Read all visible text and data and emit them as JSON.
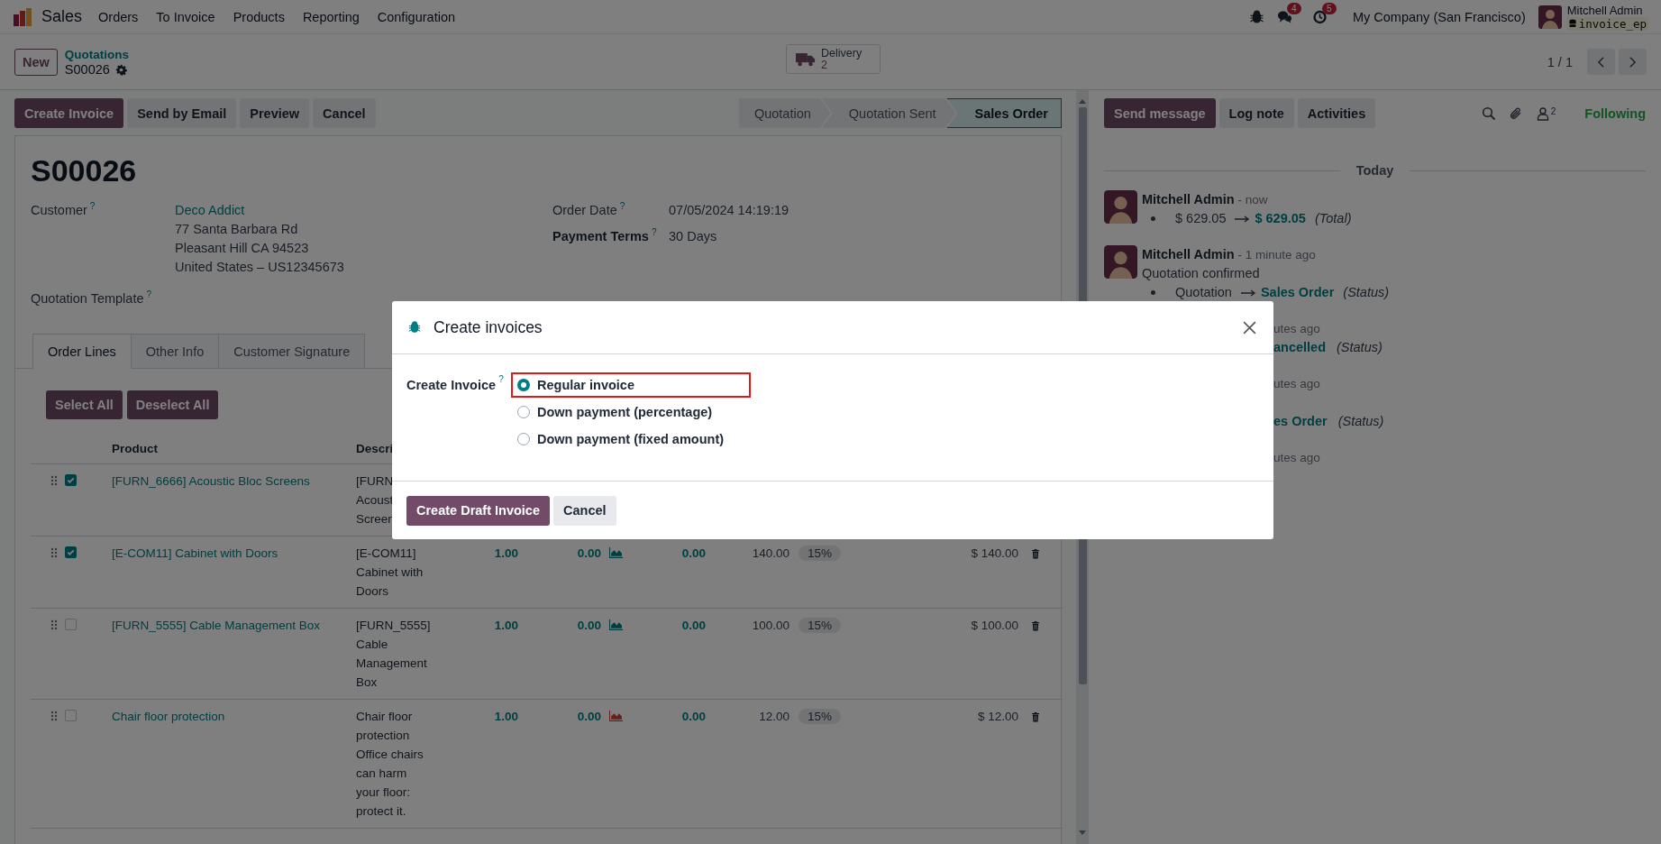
{
  "navbar": {
    "app": "Sales",
    "menu": [
      "Orders",
      "To Invoice",
      "Products",
      "Reporting",
      "Configuration"
    ],
    "messages_badge": "4",
    "activities_badge": "5",
    "company": "My Company (San Francisco)",
    "user": "Mitchell Admin",
    "database": "invoice_ep"
  },
  "control_panel": {
    "new_button": "New",
    "breadcrumb": "Quotations",
    "record": "S00026",
    "smart_button": {
      "label": "Delivery",
      "count": "2"
    },
    "pager": "1 / 1"
  },
  "actions": [
    {
      "label": "Create Invoice",
      "kind": "primary"
    },
    {
      "label": "Send by Email",
      "kind": "secondary"
    },
    {
      "label": "Preview",
      "kind": "secondary"
    },
    {
      "label": "Cancel",
      "kind": "secondary"
    }
  ],
  "status_steps": [
    {
      "label": "Quotation",
      "selected": false
    },
    {
      "label": "Quotation Sent",
      "selected": false
    },
    {
      "label": "Sales Order",
      "selected": true
    }
  ],
  "form": {
    "title": "S00026",
    "left_fields": [
      {
        "label": "Customer",
        "help": "?",
        "required": false,
        "value": "Deco Addict",
        "address": [
          "77 Santa Barbara Rd",
          "Pleasant Hill CA 94523",
          "United States – US12345673"
        ]
      },
      {
        "label": "Quotation Template",
        "help": "?",
        "required": false
      }
    ],
    "right_fields": [
      {
        "label": "Order Date",
        "help": "?",
        "required": false,
        "value": "07/05/2024 14:19:19"
      },
      {
        "label": "Payment Terms",
        "help": "?",
        "required": true,
        "value": "30 Days"
      }
    ]
  },
  "tabs": [
    {
      "label": "Order Lines",
      "selected": true
    },
    {
      "label": "Other Info",
      "selected": false
    },
    {
      "label": "Customer Signature",
      "selected": false
    }
  ],
  "line_buttons": [
    "Select All",
    "Deselect All"
  ],
  "table": {
    "columns": [
      "Product",
      "Descri"
    ],
    "rows": [
      {
        "checked": true,
        "product": "[FURN_6666] Acoustic Bloc Screens",
        "description": [
          "[FURN",
          "Acoust",
          "Screen"
        ]
      },
      {
        "checked": true,
        "product": "[E-COM11] Cabinet with Doors",
        "description": [
          "[E-COM11]",
          "Cabinet with",
          "Doors"
        ],
        "quantity": "1.00",
        "delivered": "0.00",
        "forecast": {
          "color": "#003f42"
        },
        "invoiced": "0.00",
        "unit_price": "140.00",
        "tax": "15%",
        "subtotal": "$ 140.00"
      },
      {
        "checked": false,
        "product": "[FURN_5555] Cable Management Box",
        "description": [
          "[FURN_5555]",
          "Cable",
          "Management",
          "Box"
        ],
        "quantity": "1.00",
        "delivered": "0.00",
        "forecast": {
          "color": "#003f42"
        },
        "invoiced": "0.00",
        "unit_price": "100.00",
        "tax": "15%",
        "subtotal": "$ 100.00"
      },
      {
        "checked": false,
        "product": "Chair floor protection",
        "description": [
          "Chair floor",
          "protection",
          "Office chairs",
          "can harm",
          "your floor:",
          "protect it."
        ],
        "quantity": "1.00",
        "delivered": "0.00",
        "forecast": {
          "color": "#691f1d"
        },
        "invoiced": "0.00",
        "unit_price": "12.00",
        "tax": "15%",
        "subtotal": "$ 12.00"
      }
    ]
  },
  "chatter": {
    "buttons": [
      {
        "label": "Send message",
        "kind": "primary"
      },
      {
        "label": "Log note",
        "kind": "secondary"
      },
      {
        "label": "Activities",
        "kind": "secondary"
      }
    ],
    "followers": "2",
    "follow_label": "Following",
    "date_separator": "Today",
    "messages": [
      {
        "kind": "full",
        "author": "Mitchell Admin",
        "time": "- now",
        "changes": [
          {
            "old": "$ 629.05",
            "new": "$ 629.05",
            "field": "(Total)"
          }
        ]
      },
      {
        "kind": "full",
        "author": "Mitchell Admin",
        "time": "- 1 minute ago",
        "body": "Quotation confirmed",
        "changes": [
          {
            "old": "Quotation",
            "new": "Sales Order",
            "field": "(Status)"
          }
        ]
      },
      {
        "kind": "partial",
        "time": "utes ago",
        "lines": [
          {
            "gap_before": false,
            "new": "ancelled",
            "field": "(Status)"
          }
        ]
      },
      {
        "kind": "partial",
        "time": "utes ago",
        "lines": [
          {
            "gap_before": true,
            "new": "es Order",
            "field": "(Status)"
          }
        ]
      },
      {
        "kind": "partial",
        "time": "utes ago"
      }
    ]
  },
  "modal": {
    "title": "Create invoices",
    "field_label": "Create Invoice",
    "help": "?",
    "options": [
      {
        "label": "Regular invoice",
        "selected": true,
        "highlighted": true
      },
      {
        "label": "Down payment (percentage)",
        "selected": false,
        "highlighted": false
      },
      {
        "label": "Down payment (fixed amount)",
        "selected": false,
        "highlighted": false
      }
    ],
    "buttons": [
      {
        "label": "Create Draft Invoice",
        "kind": "primary"
      },
      {
        "label": "Cancel",
        "kind": "secondary"
      }
    ]
  }
}
